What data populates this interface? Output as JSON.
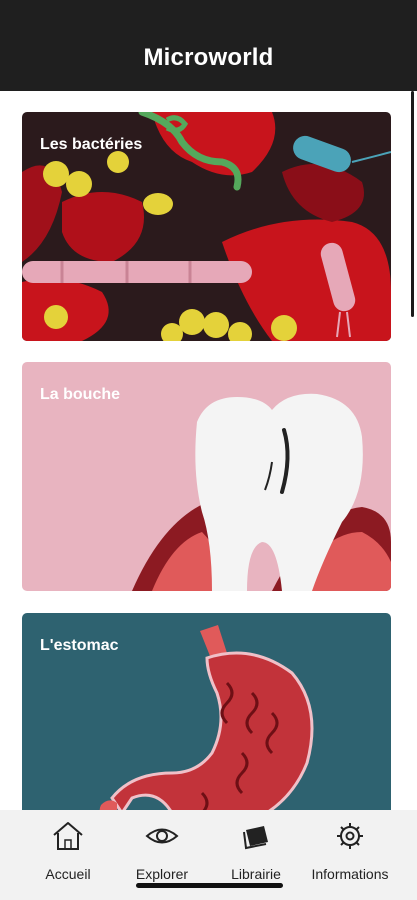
{
  "app": {
    "title": "Microworld"
  },
  "cards": [
    {
      "title": "Les bactéries"
    },
    {
      "title": "La bouche"
    },
    {
      "title": "L'estomac"
    }
  ],
  "tabs": [
    {
      "label": "Accueil",
      "icon": "home-icon"
    },
    {
      "label": "Explorer",
      "icon": "eye-icon"
    },
    {
      "label": "Librairie",
      "icon": "book-icon"
    },
    {
      "label": "Informations",
      "icon": "gear-icon"
    }
  ],
  "colors": {
    "header_bg": "#1f1f1f",
    "tabbar_bg": "#f2f2f2",
    "bacteria_bg": "#2b1a1c",
    "mouth_bg": "#e8b4c0",
    "stomach_bg": "#2e6270"
  }
}
